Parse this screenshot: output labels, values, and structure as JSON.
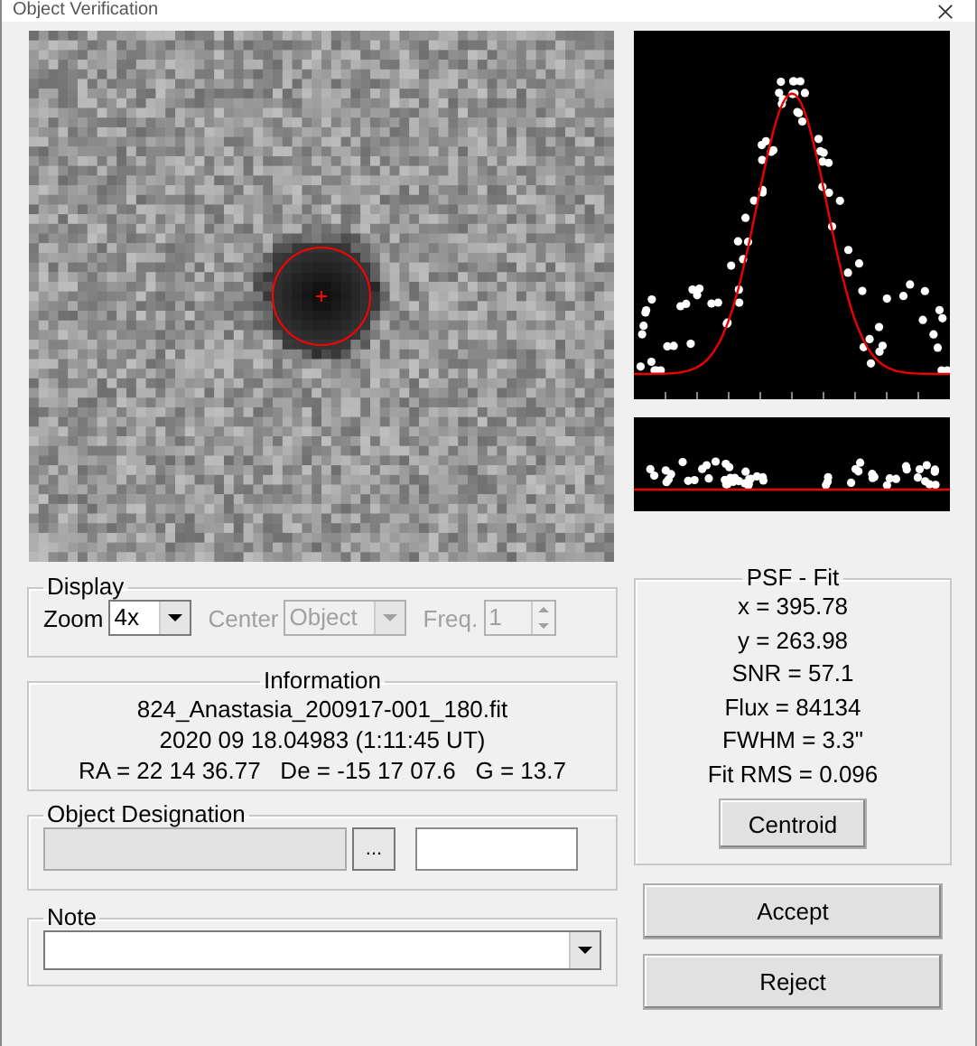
{
  "window": {
    "title": "Object Verification"
  },
  "display": {
    "title": "Display",
    "zoom": {
      "label": "Zoom",
      "value": "4x",
      "disabled": false
    },
    "center": {
      "label": "Center",
      "value": "Object",
      "disabled": true
    },
    "freq": {
      "label": "Freq.",
      "value": "1",
      "disabled": true
    }
  },
  "information": {
    "title": "Information",
    "lines": [
      "824_Anastasia_200917-001_180.fit",
      "2020 09 18.04983 (1:11:45 UT)",
      "RA = 22 14 36.77   De = -15 17 07.6   G = 13.7"
    ]
  },
  "object_designation": {
    "title": "Object Designation",
    "name_field": {
      "disabled": true
    },
    "browse_button": "...",
    "code_field": {
      "disabled": false
    }
  },
  "note": {
    "title": "Note"
  },
  "psf_fit": {
    "title": "PSF - Fit",
    "lines": [
      "x = 395.78",
      "y = 263.98",
      "SNR = 57.1",
      "Flux = 84134",
      "FWHM = 3.3\"",
      "Fit RMS = 0.096"
    ],
    "button": "Centroid"
  },
  "buttons": [
    "Accept",
    "Reject"
  ]
}
